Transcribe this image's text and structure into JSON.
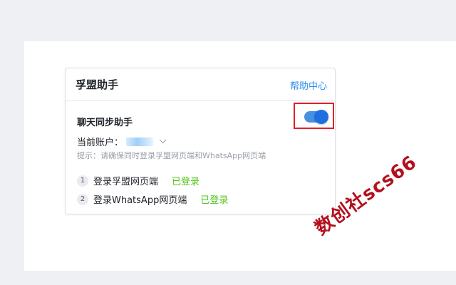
{
  "card": {
    "title": "孚盟助手",
    "help_link": "帮助中心"
  },
  "chat_sync": {
    "title": "聊天同步助手",
    "toggle_on": true,
    "account_label": "当前账户：",
    "hint": "提示：请确保同时登录孚盟网页端和WhatsApp网页端"
  },
  "steps": [
    {
      "number": "1",
      "label": "登录孚盟网页端",
      "status": "已登录"
    },
    {
      "number": "2",
      "label": "登录WhatsApp网页端",
      "status": "已登录"
    }
  ],
  "watermark": "数创社scs66",
  "colors": {
    "accent": "#2a8cf3",
    "toggle": "#1f6fe0",
    "success": "#52c41a",
    "highlight": "#e0202a",
    "watermark": "#b3101e"
  }
}
